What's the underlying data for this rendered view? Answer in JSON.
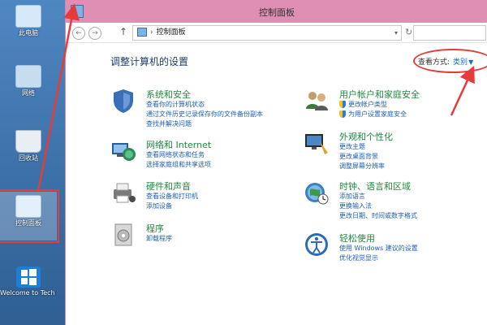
{
  "desktop": {
    "icons": [
      {
        "label": "此电脑"
      },
      {
        "label": "网络"
      },
      {
        "label": "回收站"
      },
      {
        "label": "控制面板"
      },
      {
        "label": "Welcome to Tech Previ..."
      }
    ]
  },
  "window": {
    "title": "控制面板",
    "address": {
      "separator": "›",
      "path": "控制面板"
    },
    "nav": {
      "back": "←",
      "forward": "→",
      "up": "↑",
      "refresh": "↻"
    }
  },
  "content": {
    "heading": "调整计算机的设置",
    "view_by": {
      "label": "查看方式:",
      "value": "类别",
      "caret": "▼"
    }
  },
  "categories_left": [
    {
      "title": "系统和安全",
      "links": [
        "查看你的计算机状态",
        "通过文件历史记录保存你的文件备份副本",
        "查找并解决问题"
      ],
      "icon": "shield-icon",
      "color": "#3b6fb6"
    },
    {
      "title": "网络和 Internet",
      "links": [
        "查看网络状态和任务",
        "选择家庭组和共享选项"
      ],
      "icon": "network-globe-icon",
      "color": "#2e8b57"
    },
    {
      "title": "硬件和声音",
      "links": [
        "查看设备和打印机",
        "添加设备"
      ],
      "icon": "printer-icon",
      "color": "#6b6b6b"
    },
    {
      "title": "程序",
      "links": [
        "卸载程序"
      ],
      "icon": "programs-icon",
      "color": "#8a8a8a"
    }
  ],
  "categories_right": [
    {
      "title": "用户帐户和家庭安全",
      "links": [
        "更改帐户类型",
        "为用户设置家庭安全"
      ],
      "icon": "users-icon",
      "color": "#3d7a3a"
    },
    {
      "title": "外观和个性化",
      "links": [
        "更改主题",
        "更改桌面背景",
        "调整屏幕分辨率"
      ],
      "icon": "appearance-icon",
      "color": "#4a86c8"
    },
    {
      "title": "时钟、语言和区域",
      "links": [
        "添加语言",
        "更换输入法",
        "更改日期、时间或数字格式"
      ],
      "icon": "clock-globe-icon",
      "color": "#3a7fc4"
    },
    {
      "title": "轻松使用",
      "links": [
        "使用 Windows 建议的设置",
        "优化视觉显示"
      ],
      "icon": "ease-of-access-icon",
      "color": "#2b6cb8"
    }
  ],
  "colors": {
    "accent": "#1b5fb5",
    "category_title": "#1e8a3e",
    "annotation": "#e73b3b",
    "titlebar": "#df8fb3"
  }
}
